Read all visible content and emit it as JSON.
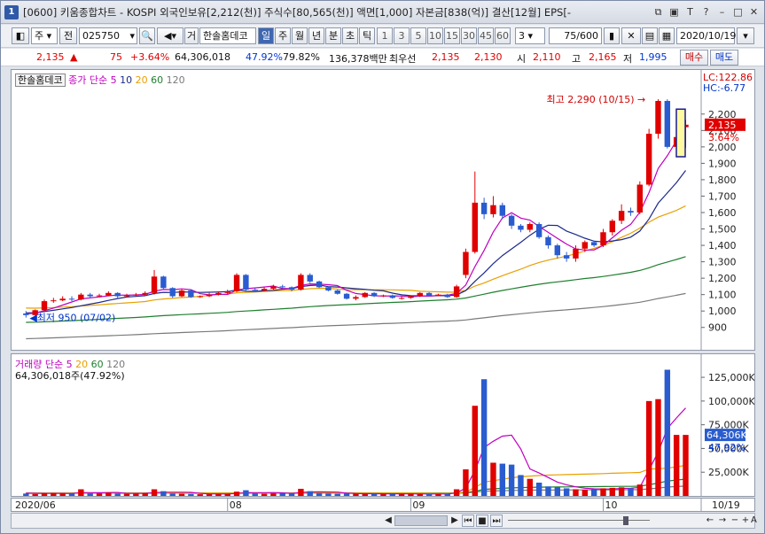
{
  "window": {
    "badge": "1",
    "title": "[0600] 키움종합차트 - KOSPI 외국인보유[2,212(천)] 주식수[80,565(천)] 액면[1,000] 자본금[838(억)] 결산[12월] EPS[-"
  },
  "toolbar": {
    "market_label": "주",
    "all_label": "전",
    "code_value": "025750",
    "stock_name": "한솔홈데코",
    "kind_label": "거",
    "periods": [
      "일",
      "주",
      "월",
      "년",
      "분",
      "초",
      "틱"
    ],
    "selected_period": "일",
    "numbers": [
      "1",
      "3",
      "5",
      "10",
      "15",
      "30",
      "45",
      "60"
    ],
    "count_select": "3",
    "range": "75/600",
    "date_value": "2020/10/19"
  },
  "quote": {
    "price": "2,135",
    "change_arrow": "▲",
    "change": "75",
    "change_pct": "+3.64%",
    "volume": "64,306,018",
    "pct1": "47.92%",
    "pct2": "79.82%",
    "amount": "136,378백만",
    "best_label": "최우선",
    "best_ask": "2,135",
    "best_bid": "2,130",
    "open_label": "시",
    "open": "2,110",
    "high_label": "고",
    "high": "2,165",
    "low_label": "저",
    "low": "1,995",
    "buy_label": "매수",
    "sell_label": "매도"
  },
  "price_panel": {
    "name": "한솔홈데코",
    "legend_prefix": "종가 단순",
    "ma": [
      "5",
      "10",
      "20",
      "60",
      "120"
    ],
    "lc": "LC:122.86",
    "hc": "HC:-6.77",
    "high_annotation": "최고 2,290 (10/15)",
    "low_annotation": "최저 950 (07/02)",
    "current_price": "2,135",
    "current_pct": "3.64%",
    "y_ticks": [
      "2,200",
      "2,100",
      "2,000",
      "1,900",
      "1,800",
      "1,700",
      "1,600",
      "1,500",
      "1,400",
      "1,300",
      "1,200",
      "1,100",
      "1,000",
      "900"
    ]
  },
  "volume_panel": {
    "title": "거래량",
    "legend_prefix": "단순",
    "ma": [
      "5",
      "20",
      "60",
      "120"
    ],
    "volume_text": "64,306,018주(47.92%)",
    "current_volume": "64,306K",
    "current_pct": "47.92%",
    "y_ticks": [
      "125,000K",
      "100,000K",
      "75,000K",
      "50,000K",
      "25,000K"
    ]
  },
  "x_axis": {
    "labels": [
      "2020/06",
      "08",
      "09",
      "10",
      "10/19"
    ]
  },
  "colors": {
    "up": "#e00000",
    "down": "#2a5cd0",
    "ma5": "#c000c0",
    "ma10": "#1c2a8a",
    "ma20": "#e8a000",
    "ma60": "#1f7f2f",
    "ma120": "#7a7a7a"
  },
  "chart_data": {
    "type": "candlestick",
    "ylim": [
      850,
      2350
    ],
    "volume_ylim": [
      0,
      140000
    ],
    "x": [
      "07/02",
      "07/03",
      "07/06",
      "07/07",
      "07/08",
      "07/09",
      "07/10",
      "07/13",
      "07/14",
      "07/15",
      "07/16",
      "07/17",
      "07/20",
      "07/21",
      "07/22",
      "07/23",
      "07/24",
      "07/27",
      "07/28",
      "07/29",
      "07/30",
      "07/31",
      "08/03",
      "08/04",
      "08/05",
      "08/06",
      "08/07",
      "08/10",
      "08/11",
      "08/12",
      "08/13",
      "08/14",
      "08/18",
      "08/19",
      "08/20",
      "08/21",
      "08/24",
      "08/25",
      "08/26",
      "08/27",
      "08/28",
      "08/31",
      "09/01",
      "09/02",
      "09/03",
      "09/04",
      "09/07",
      "09/08",
      "09/09",
      "09/10",
      "09/11",
      "09/14",
      "09/15",
      "09/16",
      "09/17",
      "09/18",
      "09/21",
      "09/22",
      "09/23",
      "09/24",
      "09/25",
      "09/28",
      "09/29",
      "10/05",
      "10/06",
      "10/07",
      "10/08",
      "10/12",
      "10/13",
      "10/14",
      "10/15",
      "10/16",
      "10/19"
    ],
    "open": [
      985,
      975,
      1005,
      1060,
      1065,
      1075,
      1070,
      1100,
      1090,
      1095,
      1110,
      1090,
      1095,
      1100,
      1110,
      1210,
      1140,
      1090,
      1125,
      1085,
      1090,
      1100,
      1110,
      1120,
      1220,
      1130,
      1125,
      1135,
      1150,
      1145,
      1130,
      1220,
      1180,
      1145,
      1125,
      1105,
      1075,
      1085,
      1110,
      1090,
      1095,
      1080,
      1080,
      1090,
      1110,
      1095,
      1100,
      1085,
      1220,
      1360,
      1660,
      1590,
      1645,
      1580,
      1520,
      1495,
      1530,
      1450,
      1400,
      1340,
      1320,
      1380,
      1420,
      1400,
      1480,
      1550,
      1610,
      1600,
      1770,
      2080,
      2280,
      2000,
      2120
    ],
    "close": [
      975,
      1005,
      1060,
      1065,
      1075,
      1070,
      1100,
      1090,
      1095,
      1110,
      1090,
      1095,
      1100,
      1110,
      1210,
      1140,
      1090,
      1125,
      1085,
      1090,
      1100,
      1110,
      1120,
      1220,
      1130,
      1125,
      1135,
      1150,
      1145,
      1130,
      1220,
      1180,
      1145,
      1125,
      1105,
      1075,
      1085,
      1110,
      1090,
      1095,
      1080,
      1080,
      1090,
      1110,
      1095,
      1100,
      1085,
      1150,
      1360,
      1660,
      1590,
      1645,
      1580,
      1520,
      1495,
      1530,
      1450,
      1400,
      1340,
      1320,
      1380,
      1420,
      1400,
      1480,
      1550,
      1610,
      1600,
      1770,
      2080,
      2280,
      2000,
      2060,
      2135
    ],
    "high": [
      1000,
      1010,
      1070,
      1080,
      1090,
      1090,
      1110,
      1110,
      1105,
      1120,
      1115,
      1105,
      1110,
      1120,
      1250,
      1215,
      1145,
      1135,
      1130,
      1095,
      1110,
      1120,
      1130,
      1230,
      1225,
      1140,
      1145,
      1160,
      1160,
      1150,
      1230,
      1230,
      1185,
      1150,
      1130,
      1110,
      1095,
      1115,
      1115,
      1100,
      1100,
      1090,
      1095,
      1115,
      1115,
      1105,
      1105,
      1160,
      1380,
      1850,
      1690,
      1700,
      1660,
      1590,
      1530,
      1540,
      1540,
      1460,
      1410,
      1360,
      1400,
      1430,
      1430,
      1500,
      1560,
      1650,
      1630,
      1790,
      2110,
      2290,
      2290,
      2160,
      2165
    ],
    "low": [
      960,
      970,
      1000,
      1050,
      1060,
      1060,
      1065,
      1080,
      1085,
      1090,
      1080,
      1085,
      1090,
      1095,
      1100,
      1130,
      1080,
      1085,
      1080,
      1080,
      1085,
      1095,
      1100,
      1115,
      1120,
      1115,
      1120,
      1130,
      1140,
      1120,
      1125,
      1170,
      1140,
      1120,
      1100,
      1070,
      1065,
      1080,
      1085,
      1085,
      1075,
      1070,
      1075,
      1085,
      1090,
      1090,
      1080,
      1080,
      1200,
      1350,
      1560,
      1570,
      1560,
      1500,
      1480,
      1480,
      1440,
      1380,
      1320,
      1300,
      1300,
      1360,
      1390,
      1390,
      1460,
      1530,
      1580,
      1590,
      1760,
      2050,
      1990,
      1980,
      1995
    ],
    "volume": [
      2500,
      2000,
      2800,
      3000,
      2600,
      2300,
      7000,
      2500,
      2600,
      3500,
      2400,
      2200,
      2300,
      3000,
      7000,
      5000,
      2500,
      2200,
      2000,
      1800,
      2100,
      2000,
      2200,
      4500,
      6000,
      2500,
      2200,
      2600,
      3000,
      2800,
      7500,
      5000,
      3000,
      2500,
      2200,
      2400,
      2300,
      2200,
      2400,
      2000,
      2100,
      2000,
      2100,
      2200,
      2100,
      2000,
      2000,
      7000,
      28000,
      95000,
      123000,
      35000,
      34000,
      33000,
      22000,
      18000,
      14000,
      10000,
      9000,
      8000,
      7000,
      6500,
      7000,
      8000,
      8500,
      9000,
      8000,
      12000,
      100000,
      102000,
      133000,
      64306,
      64306
    ]
  }
}
